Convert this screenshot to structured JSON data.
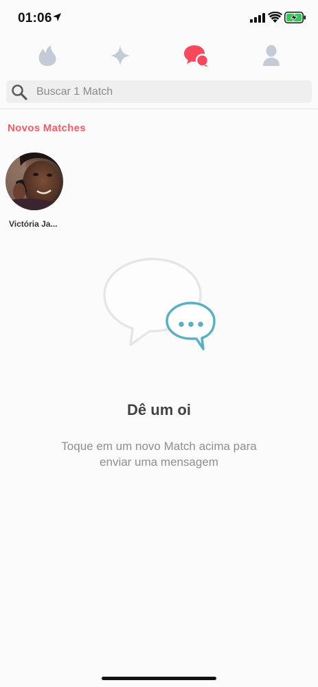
{
  "status_bar": {
    "time": "01:06",
    "icons": [
      "location-arrow-icon",
      "cellular-signal-icon",
      "wifi-icon",
      "battery-charging-icon"
    ]
  },
  "nav": {
    "tabs": [
      {
        "name": "discover",
        "icon": "flame-icon",
        "active": false
      },
      {
        "name": "top-picks",
        "icon": "sparkle-icon",
        "active": false
      },
      {
        "name": "messages",
        "icon": "chat-bubbles-icon",
        "active": true
      },
      {
        "name": "profile",
        "icon": "person-icon",
        "active": false
      }
    ]
  },
  "search": {
    "placeholder": "Buscar 1 Match",
    "value": ""
  },
  "new_matches": {
    "title": "Novos Matches",
    "items": [
      {
        "name": "Victória Ja..."
      }
    ]
  },
  "empty_state": {
    "illustration": "chat-bubbles-illustration",
    "title": "Dê um oi",
    "text_line1": "Toque em um novo Match acima para",
    "text_line2": "enviar uma mensagem"
  },
  "colors": {
    "accent": "#fe5864",
    "inactive_icon": "#c5cbd6",
    "bubble_teal": "#58b0c4",
    "bubble_grey": "#e6e6e6"
  }
}
